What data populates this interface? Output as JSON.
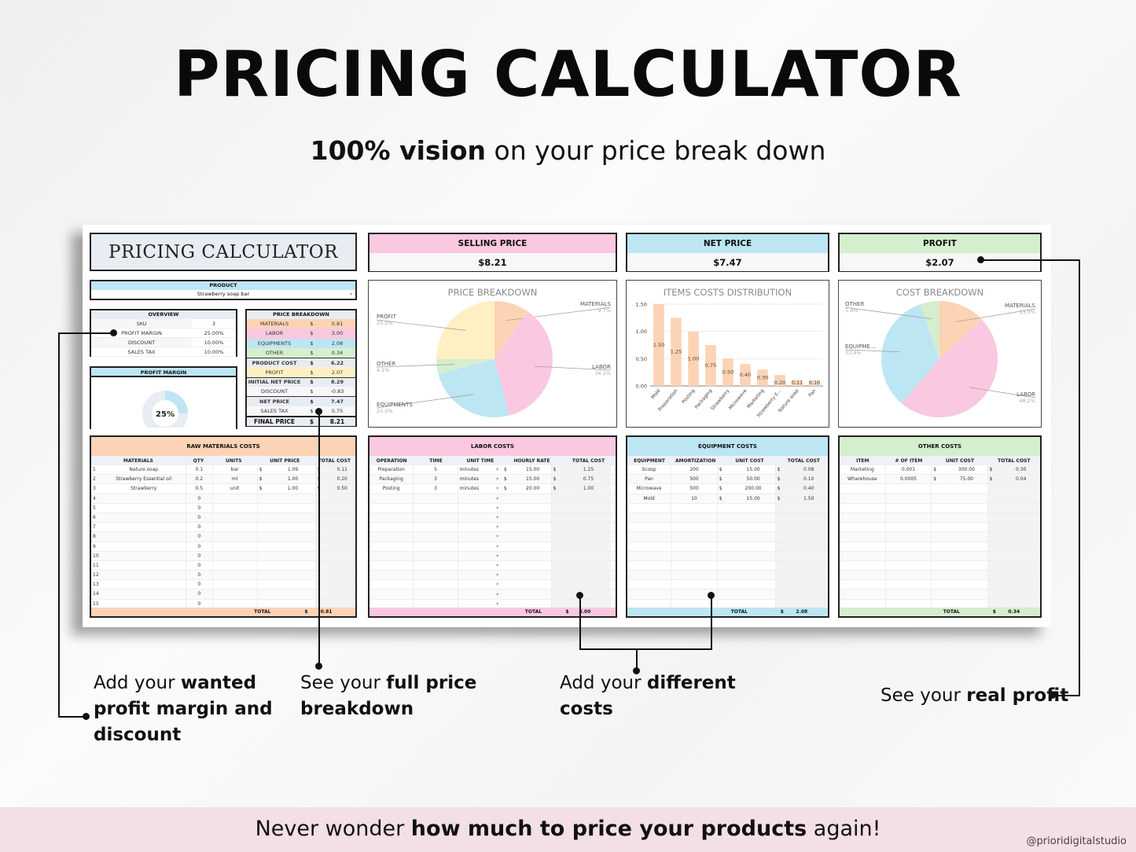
{
  "header": {
    "title": "PRICING CALCULATOR",
    "subtitle_bold": "100% vision",
    "subtitle_rest": " on your price break down"
  },
  "app": {
    "title": "PRICING CALCULATOR",
    "product": {
      "label": "PRODUCT",
      "value": "Strawberry soap bar"
    },
    "overview": {
      "label": "OVERVIEW",
      "rows": [
        {
          "label": "SKU",
          "value": "3"
        },
        {
          "label": "PROFIT MARGIN",
          "value": "25.00%"
        },
        {
          "label": "DISCOUNT",
          "value": "10.00%"
        },
        {
          "label": "SALES TAX",
          "value": "10.00%"
        }
      ]
    },
    "profit_margin": {
      "label": "PROFIT MARGIN",
      "value_text": "25%",
      "fraction": 0.25
    },
    "price_breakdown": {
      "label": "PRICE BREAKDOWN",
      "rows": [
        {
          "label": "MATERIALS",
          "cur": "$",
          "value": "0.81",
          "color": "#fdd3b5"
        },
        {
          "label": "LABOR",
          "cur": "$",
          "value": "3.00",
          "color": "#fac8e0"
        },
        {
          "label": "EQUIPMENTS",
          "cur": "$",
          "value": "2.08",
          "color": "#bde6f3"
        },
        {
          "label": "OTHER",
          "cur": "$",
          "value": "0.34",
          "color": "#d5eecd"
        },
        {
          "label": "PRODUCT COST",
          "cur": "$",
          "value": "6.22",
          "color": "#e8edf4",
          "bold": true
        },
        {
          "label": "PROFIT",
          "cur": "$",
          "value": "2.07",
          "color": "#fff0c4"
        },
        {
          "label": "INITIAL NET PRICE",
          "cur": "$",
          "value": "8.29",
          "color": "#e8edf4",
          "bold": true
        },
        {
          "label": "DISCOUNT",
          "cur": "$",
          "value": "-0.83",
          "color": "#f7f7f7"
        },
        {
          "label": "NET PRICE",
          "cur": "$",
          "value": "7.47",
          "color": "#e8edf4",
          "bold": true
        },
        {
          "label": "SALES TAX",
          "cur": "$",
          "value": "0.75",
          "color": "#f7f7f7"
        }
      ],
      "final": {
        "label": "FINAL PRICE",
        "cur": "$",
        "value": "8.21"
      }
    },
    "kpis": [
      {
        "label": "SELLING PRICE",
        "value": "$8.21",
        "color": "#fac8e0"
      },
      {
        "label": "NET PRICE",
        "value": "$7.47",
        "color": "#bde6f3"
      },
      {
        "label": "PROFIT",
        "value": "$2.07",
        "color": "#d5eecd"
      }
    ],
    "raw_materials": {
      "title": "RAW MATERIALS COSTS",
      "color": "#fdd3b5",
      "columns": [
        "MATERIALS",
        "QTY",
        "UNITS",
        "UNIT PRICE",
        "TOTAL COST"
      ],
      "rows": [
        [
          "1",
          "Nature soap",
          "0.1",
          "bar",
          "$",
          "1.09",
          "$",
          "0.11"
        ],
        [
          "2",
          "Strawberry Essential oil",
          "0.2",
          "ml",
          "$",
          "1.00",
          "$",
          "0.20"
        ],
        [
          "3",
          "Strawberry",
          "0.5",
          "unit",
          "$",
          "1.00",
          "$",
          "0.50"
        ],
        [
          "4",
          "",
          "0",
          "",
          "",
          "",
          "",
          ""
        ],
        [
          "5",
          "",
          "0",
          "",
          "",
          "",
          "",
          ""
        ],
        [
          "6",
          "",
          "0",
          "",
          "",
          "",
          "",
          ""
        ],
        [
          "7",
          "",
          "0",
          "",
          "",
          "",
          "",
          ""
        ],
        [
          "8",
          "",
          "0",
          "",
          "",
          "",
          "",
          ""
        ],
        [
          "9",
          "",
          "0",
          "",
          "",
          "",
          "",
          ""
        ],
        [
          "10",
          "",
          "0",
          "",
          "",
          "",
          "",
          ""
        ],
        [
          "11",
          "",
          "0",
          "",
          "",
          "",
          "",
          ""
        ],
        [
          "12",
          "",
          "0",
          "",
          "",
          "",
          "",
          ""
        ],
        [
          "13",
          "",
          "0",
          "",
          "",
          "",
          "",
          ""
        ],
        [
          "14",
          "",
          "0",
          "",
          "",
          "",
          "",
          ""
        ],
        [
          "15",
          "",
          "0",
          "",
          "",
          "",
          "",
          ""
        ]
      ],
      "total": {
        "label": "TOTAL",
        "cur": "$",
        "value": "0.81"
      }
    },
    "labor": {
      "title": "LABOR COSTS",
      "color": "#fac8e0",
      "columns": [
        "OPERATION",
        "TIME",
        "UNIT TIME",
        "HOURLY RATE",
        "TOTAL COST"
      ],
      "rows": [
        [
          "Preparation",
          "5",
          "minutes",
          "$",
          "15.00",
          "$",
          "1.25"
        ],
        [
          "Packaging",
          "3",
          "minutes",
          "$",
          "15.00",
          "$",
          "0.75"
        ],
        [
          "Posting",
          "3",
          "minutes",
          "$",
          "20.00",
          "$",
          "1.00"
        ],
        [
          "",
          "",
          "",
          "",
          "",
          "",
          ""
        ],
        [
          "",
          "",
          "",
          "",
          "",
          "",
          ""
        ],
        [
          "",
          "",
          "",
          "",
          "",
          "",
          ""
        ],
        [
          "",
          "",
          "",
          "",
          "",
          "",
          ""
        ],
        [
          "",
          "",
          "",
          "",
          "",
          "",
          ""
        ],
        [
          "",
          "",
          "",
          "",
          "",
          "",
          ""
        ],
        [
          "",
          "",
          "",
          "",
          "",
          "",
          ""
        ],
        [
          "",
          "",
          "",
          "",
          "",
          "",
          ""
        ],
        [
          "",
          "",
          "",
          "",
          "",
          "",
          ""
        ],
        [
          "",
          "",
          "",
          "",
          "",
          "",
          ""
        ],
        [
          "",
          "",
          "",
          "",
          "",
          "",
          ""
        ],
        [
          "",
          "",
          "",
          "",
          "",
          "",
          ""
        ]
      ],
      "total": {
        "label": "TOTAL",
        "cur": "$",
        "value": "3.00"
      }
    },
    "equipment": {
      "title": "EQUIPMENT COSTS",
      "color": "#bde6f3",
      "columns": [
        "EQUIPMENT",
        "AMORTIZATION",
        "UNIT COST",
        "TOTAL COST"
      ],
      "rows": [
        [
          "Scoop",
          "200",
          "$",
          "15.00",
          "$",
          "0.08"
        ],
        [
          "Pan",
          "500",
          "$",
          "50.00",
          "$",
          "0.10"
        ],
        [
          "Microwave",
          "500",
          "$",
          "200.00",
          "$",
          "0.40"
        ],
        [
          "Mold",
          "10",
          "$",
          "15.00",
          "$",
          "1.50"
        ],
        [
          "",
          "",
          "",
          "",
          "",
          ""
        ],
        [
          "",
          "",
          "",
          "",
          "",
          ""
        ],
        [
          "",
          "",
          "",
          "",
          "",
          ""
        ],
        [
          "",
          "",
          "",
          "",
          "",
          ""
        ],
        [
          "",
          "",
          "",
          "",
          "",
          ""
        ],
        [
          "",
          "",
          "",
          "",
          "",
          ""
        ],
        [
          "",
          "",
          "",
          "",
          "",
          ""
        ],
        [
          "",
          "",
          "",
          "",
          "",
          ""
        ],
        [
          "",
          "",
          "",
          "",
          "",
          ""
        ],
        [
          "",
          "",
          "",
          "",
          "",
          ""
        ],
        [
          "",
          "",
          "",
          "",
          "",
          ""
        ]
      ],
      "total": {
        "label": "TOTAL",
        "cur": "$",
        "value": "2.08"
      }
    },
    "other": {
      "title": "OTHER COSTS",
      "color": "#d5eecd",
      "columns": [
        "ITEM",
        "# OF ITEM",
        "UNIT COST",
        "TOTAL COST"
      ],
      "rows": [
        [
          "Marketing",
          "0.001",
          "$",
          "300.00",
          "$",
          "0.30"
        ],
        [
          "Wharehouse",
          "0.0005",
          "$",
          "75.00",
          "$",
          "0.04"
        ],
        [
          "",
          "",
          "",
          "",
          "",
          ""
        ],
        [
          "",
          "",
          "",
          "",
          "",
          ""
        ],
        [
          "",
          "",
          "",
          "",
          "",
          ""
        ],
        [
          "",
          "",
          "",
          "",
          "",
          ""
        ],
        [
          "",
          "",
          "",
          "",
          "",
          ""
        ],
        [
          "",
          "",
          "",
          "",
          "",
          ""
        ],
        [
          "",
          "",
          "",
          "",
          "",
          ""
        ],
        [
          "",
          "",
          "",
          "",
          "",
          ""
        ],
        [
          "",
          "",
          "",
          "",
          "",
          ""
        ],
        [
          "",
          "",
          "",
          "",
          "",
          ""
        ],
        [
          "",
          "",
          "",
          "",
          "",
          ""
        ],
        [
          "",
          "",
          "",
          "",
          "",
          ""
        ],
        [
          "",
          "",
          "",
          "",
          "",
          ""
        ]
      ],
      "total": {
        "label": "TOTAL",
        "cur": "$",
        "value": "0.34"
      }
    }
  },
  "chart_data": [
    {
      "type": "pie",
      "title": "PRICE BREAKDOWN",
      "slices": [
        {
          "label": "MATERIALS",
          "pct": 9.7,
          "pct_text": "9.7%",
          "color": "#fdd3b5"
        },
        {
          "label": "LABOR",
          "pct": 36.2,
          "pct_text": "36.2%",
          "color": "#fac8e0"
        },
        {
          "label": "EQUIPMENTS",
          "pct": 25.0,
          "pct_text": "25.0%",
          "color": "#bde6f3"
        },
        {
          "label": "OTHER",
          "pct": 4.1,
          "pct_text": "4.1%",
          "color": "#d5eecd"
        },
        {
          "label": "PROFIT",
          "pct": 25.0,
          "pct_text": "25.0%",
          "color": "#fff0c4"
        }
      ]
    },
    {
      "type": "bar",
      "title": "ITEMS COSTS DISTRIBUTION",
      "categories": [
        "Mold",
        "Preparation",
        "Posting",
        "Packaging",
        "Strawberry",
        "Microwave",
        "Marketing",
        "Strawberry E...",
        "Nature soap",
        "Pan"
      ],
      "values": [
        1.5,
        1.25,
        1.0,
        0.75,
        0.5,
        0.4,
        0.3,
        0.2,
        0.11,
        0.1
      ],
      "value_labels": [
        "1.50",
        "1.25",
        "1.00",
        "0.75",
        "0.50",
        "0.40",
        "0.30",
        "0.20",
        "0.11",
        "0.10"
      ],
      "yticks": [
        "0.00",
        "0.50",
        "1.00",
        "1.50"
      ],
      "ylim": [
        0,
        1.5
      ],
      "color": "#fdd3b5",
      "grid": true
    },
    {
      "type": "pie",
      "title": "COST BREAKDOWN",
      "slices": [
        {
          "label": "MATERIALS",
          "pct": 13.0,
          "pct_text": "13.0%",
          "color": "#fdd3b5"
        },
        {
          "label": "LABOR",
          "pct": 48.2,
          "pct_text": "48.2%",
          "color": "#fac8e0"
        },
        {
          "label": "EQUIPME...",
          "pct": 33.4,
          "pct_text": "33.4%",
          "color": "#bde6f3"
        },
        {
          "label": "OTHER",
          "pct": 5.4,
          "pct_text": "5.4%",
          "color": "#d5eecd"
        }
      ]
    }
  ],
  "annotations": {
    "a1": {
      "pre": "Add your ",
      "bold1": "wanted",
      "bold2": "profit margin and",
      "bold3": "discount"
    },
    "a2": {
      "pre": "See your ",
      "bold1": "full price",
      "bold2": "breakdown"
    },
    "a3": {
      "pre": "Add your ",
      "bold1": "different",
      "bold2": "costs"
    },
    "a4": {
      "pre": "See your ",
      "bold1": "real profit"
    }
  },
  "footer": {
    "pre": "Never wonder ",
    "bold": "how much to price your products",
    "post": " again!",
    "handle": "@prioridigitalstudio"
  }
}
